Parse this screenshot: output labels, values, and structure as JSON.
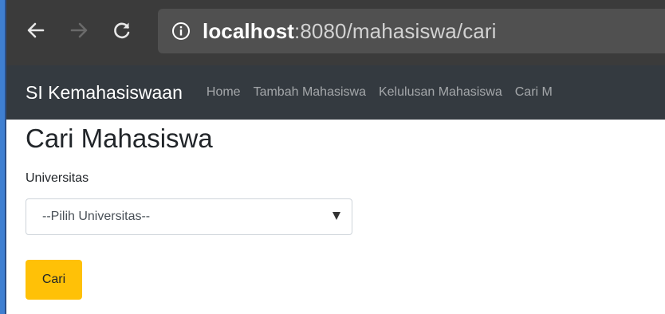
{
  "browser": {
    "url_host": "localhost",
    "url_rest": ":8080/mahasiswa/cari",
    "icons": {
      "back": "arrow-left-icon",
      "forward": "arrow-right-icon",
      "reload": "reload-icon",
      "info": "info-icon"
    }
  },
  "navbar": {
    "brand": "SI Kemahasiswaan",
    "links": [
      "Home",
      "Tambah Mahasiswa",
      "Kelulusan Mahasiswa",
      "Cari M"
    ]
  },
  "main": {
    "title": "Cari Mahasiswa",
    "universitas_label": "Universitas",
    "universitas_selected": "--Pilih Universitas--",
    "search_button": "Cari"
  },
  "colors": {
    "toolbar": "#3b3b3b",
    "omnibox": "#505050",
    "navbar": "#343a40",
    "button_warning": "#ffc107"
  }
}
